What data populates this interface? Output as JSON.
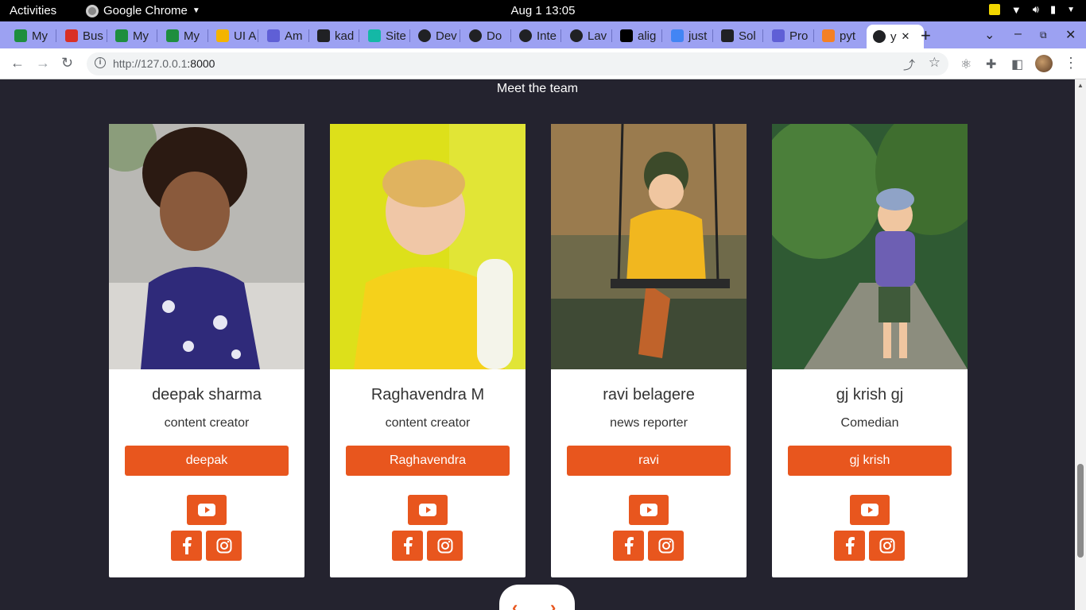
{
  "desktop": {
    "activities": "Activities",
    "app_name": "Google Chrome",
    "clock": "Aug 1  13:05"
  },
  "browser": {
    "tabs": [
      {
        "label": "My",
        "icon": "google-drive-icon",
        "color": "#1e8e3e"
      },
      {
        "label": "Bus",
        "icon": "gmail-icon",
        "color": "#d93025"
      },
      {
        "label": "My",
        "icon": "google-drive-icon",
        "color": "#1e8e3e"
      },
      {
        "label": "My",
        "icon": "google-drive-icon",
        "color": "#1e8e3e"
      },
      {
        "label": "UI A",
        "icon": "wix-icon",
        "color": "#f4b400"
      },
      {
        "label": "Am",
        "icon": "amplify-icon",
        "color": "#5f5fd6"
      },
      {
        "label": "kad",
        "icon": "github-icon",
        "color": "#202124"
      },
      {
        "label": "Site",
        "icon": "diamond-icon",
        "color": "#14b8a6"
      },
      {
        "label": "Dev",
        "icon": "globe-icon",
        "color": "#202124"
      },
      {
        "label": "Do",
        "icon": "globe-icon",
        "color": "#202124"
      },
      {
        "label": "Inte",
        "icon": "globe-icon",
        "color": "#202124"
      },
      {
        "label": "Lav",
        "icon": "globe-icon",
        "color": "#202124"
      },
      {
        "label": "alig",
        "icon": "medium-icon",
        "color": "#000000"
      },
      {
        "label": "just",
        "icon": "google-icon",
        "color": "#4285f4"
      },
      {
        "label": "Sol",
        "icon": "github-icon",
        "color": "#202124"
      },
      {
        "label": "Pro",
        "icon": "amplify-icon",
        "color": "#5f5fd6"
      },
      {
        "label": "pyt",
        "icon": "stackoverflow-icon",
        "color": "#f48024"
      },
      {
        "label": "y",
        "icon": "globe-icon",
        "color": "#202124",
        "active": true
      }
    ],
    "url_host": "http://127.0.0.1",
    "url_port": ":8000"
  },
  "page": {
    "section_title": "Meet the team",
    "accent_color": "#e8561e",
    "members": [
      {
        "name": "deepak sharma",
        "role": "content creator",
        "button": "deepak"
      },
      {
        "name": "Raghavendra M",
        "role": "content creator",
        "button": "Raghavendra"
      },
      {
        "name": "ravi belagere",
        "role": "news reporter",
        "button": "ravi"
      },
      {
        "name": "gj krish gj",
        "role": "Comedian",
        "button": "gj krish"
      }
    ],
    "pager": {
      "prev": "‹",
      "next": "›"
    }
  }
}
